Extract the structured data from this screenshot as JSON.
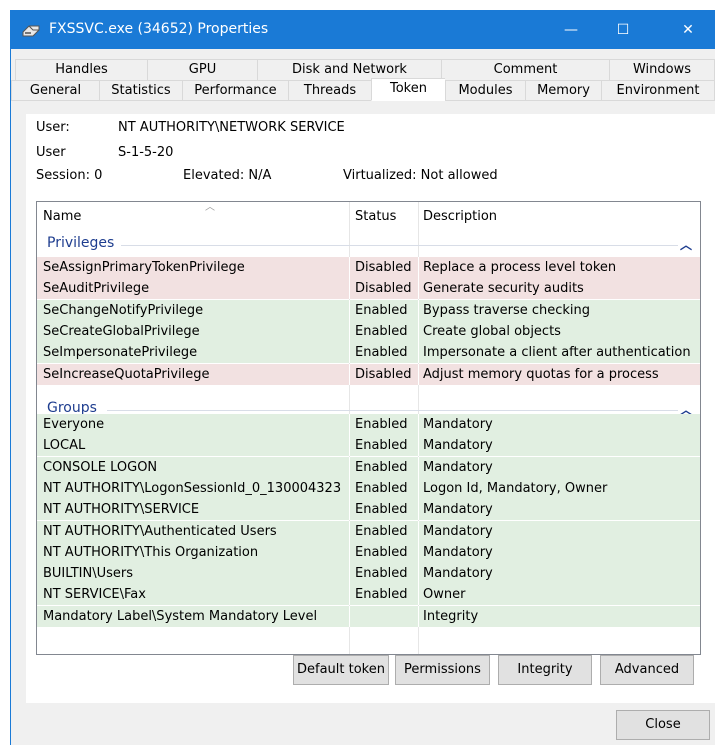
{
  "window": {
    "title": "FXSSVC.exe (34652) Properties",
    "controls": {
      "minimize": "—",
      "maximize": "☐",
      "close": "✕"
    },
    "accent_color": "#1a7ad6"
  },
  "tabs": {
    "row1": [
      "Handles",
      "GPU",
      "Disk and Network",
      "Comment",
      "Windows"
    ],
    "row2": [
      "General",
      "Statistics",
      "Performance",
      "Threads",
      "Token",
      "Modules",
      "Memory",
      "Environment"
    ],
    "active": "Token"
  },
  "token": {
    "user_label": "User:",
    "user_value": "NT AUTHORITY\\NETWORK SERVICE",
    "sid_label": "User",
    "sid_value": "S-1-5-20",
    "session": "Session: 0",
    "elevated": "Elevated: N/A",
    "virtualized": "Virtualized: Not allowed"
  },
  "list": {
    "columns": {
      "name": "Name",
      "status": "Status",
      "description": "Description"
    },
    "privileges_title": "Privileges",
    "groups_title": "Groups",
    "privileges": [
      {
        "name": "SeAssignPrimaryTokenPrivilege",
        "status": "Disabled",
        "description": "Replace a process level token"
      },
      {
        "name": "SeAuditPrivilege",
        "status": "Disabled",
        "description": "Generate security audits"
      },
      {
        "name": "SeChangeNotifyPrivilege",
        "status": "Enabled",
        "description": "Bypass traverse checking"
      },
      {
        "name": "SeCreateGlobalPrivilege",
        "status": "Enabled",
        "description": "Create global objects"
      },
      {
        "name": "SeImpersonatePrivilege",
        "status": "Enabled",
        "description": "Impersonate a client after authentication"
      },
      {
        "name": "SeIncreaseQuotaPrivilege",
        "status": "Disabled",
        "description": "Adjust memory quotas for a process"
      }
    ],
    "groups": [
      {
        "name": "Everyone",
        "status": "Enabled",
        "description": "Mandatory"
      },
      {
        "name": "LOCAL",
        "status": "Enabled",
        "description": "Mandatory"
      },
      {
        "name": "CONSOLE LOGON",
        "status": "Enabled",
        "description": "Mandatory"
      },
      {
        "name": "NT AUTHORITY\\LogonSessionId_0_130004323",
        "status": "Enabled",
        "description": "Logon Id, Mandatory, Owner"
      },
      {
        "name": "NT AUTHORITY\\SERVICE",
        "status": "Enabled",
        "description": "Mandatory"
      },
      {
        "name": "NT AUTHORITY\\Authenticated Users",
        "status": "Enabled",
        "description": "Mandatory"
      },
      {
        "name": "NT AUTHORITY\\This Organization",
        "status": "Enabled",
        "description": "Mandatory"
      },
      {
        "name": "BUILTIN\\Users",
        "status": "Enabled",
        "description": "Mandatory"
      },
      {
        "name": "NT SERVICE\\Fax",
        "status": "Enabled",
        "description": "Owner"
      },
      {
        "name": "Mandatory Label\\System Mandatory Level",
        "status": "",
        "description": "Integrity"
      }
    ],
    "enabled_color": "#e1efe1",
    "disabled_color": "#f2e1e1"
  },
  "buttons": {
    "default_token": "Default token",
    "permissions": "Permissions",
    "integrity": "Integrity",
    "advanced": "Advanced",
    "close": "Close"
  }
}
